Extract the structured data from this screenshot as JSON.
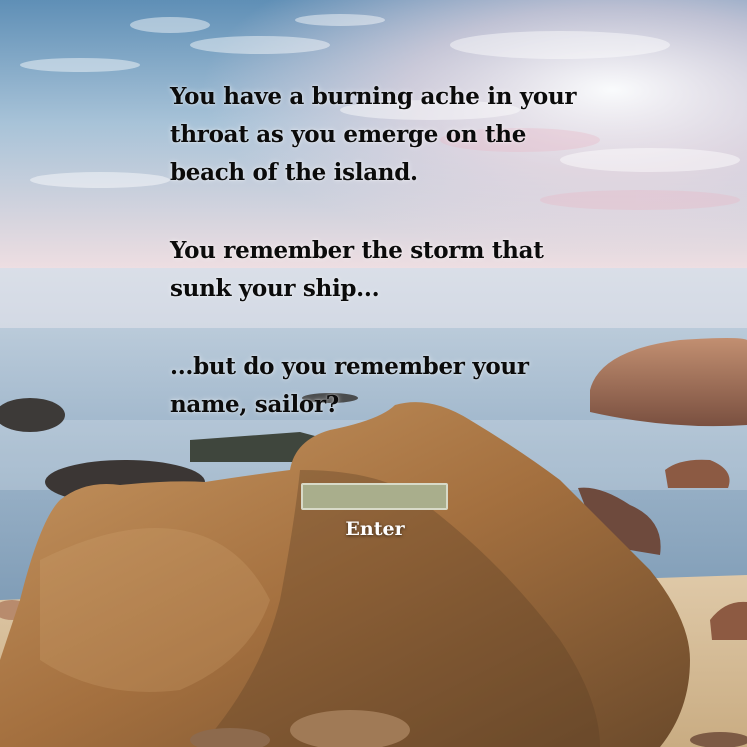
{
  "story": {
    "paragraph1": "You have a burning ache in your throat as you emerge on the beach of the island.",
    "paragraph2": "You remember the storm that sunk your ship...",
    "paragraph3": "...but do you remember your name, sailor?"
  },
  "name_input": {
    "value": "",
    "placeholder": ""
  },
  "enter_button": {
    "label": "Enter"
  },
  "colors": {
    "text": "#0b0b0b",
    "input_fill": "#a9ae8c",
    "button_text": "#ffffff"
  },
  "background": {
    "icon": "beach-rocks-sunset-scene"
  }
}
